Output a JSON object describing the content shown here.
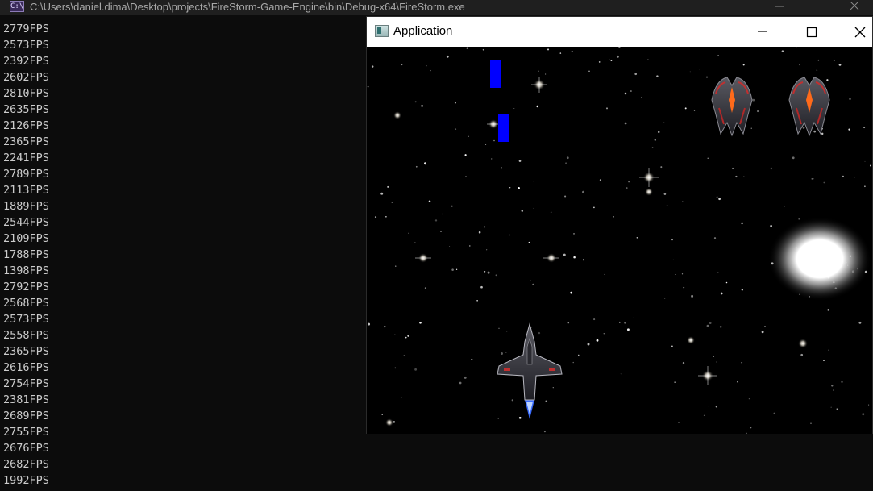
{
  "console": {
    "title": "C:\\Users\\daniel.dima\\Desktop\\projects\\FireStorm-Game-Engine\\bin\\Debug-x64\\FireStorm.exe",
    "icon": "console-app-icon",
    "icon_text": "C:\\",
    "buttons": [
      "minimize-icon",
      "maximize-icon",
      "close-icon"
    ],
    "fps_lines": [
      "2779FPS",
      "2573FPS",
      "2392FPS",
      "2602FPS",
      "2810FPS",
      "2635FPS",
      "2126FPS",
      "2365FPS",
      "2241FPS",
      "2789FPS",
      "2113FPS",
      "1889FPS",
      "2544FPS",
      "2109FPS",
      "1788FPS",
      "1398FPS",
      "2792FPS",
      "2568FPS",
      "2573FPS",
      "2558FPS",
      "2365FPS",
      "2616FPS",
      "2754FPS",
      "2381FPS",
      "2689FPS",
      "2755FPS",
      "2676FPS",
      "2682FPS",
      "1992FPS"
    ]
  },
  "app": {
    "title": "Application",
    "icon": "app-window-icon",
    "buttons": [
      "minimize-icon",
      "maximize-icon",
      "close-icon"
    ]
  },
  "game": {
    "background": "#000000",
    "projectile_color": "#0000ff",
    "entities": [
      "blue-projectile",
      "blue-projectile",
      "enemy-ship",
      "enemy-ship",
      "player-ship",
      "glowing-planet"
    ]
  }
}
